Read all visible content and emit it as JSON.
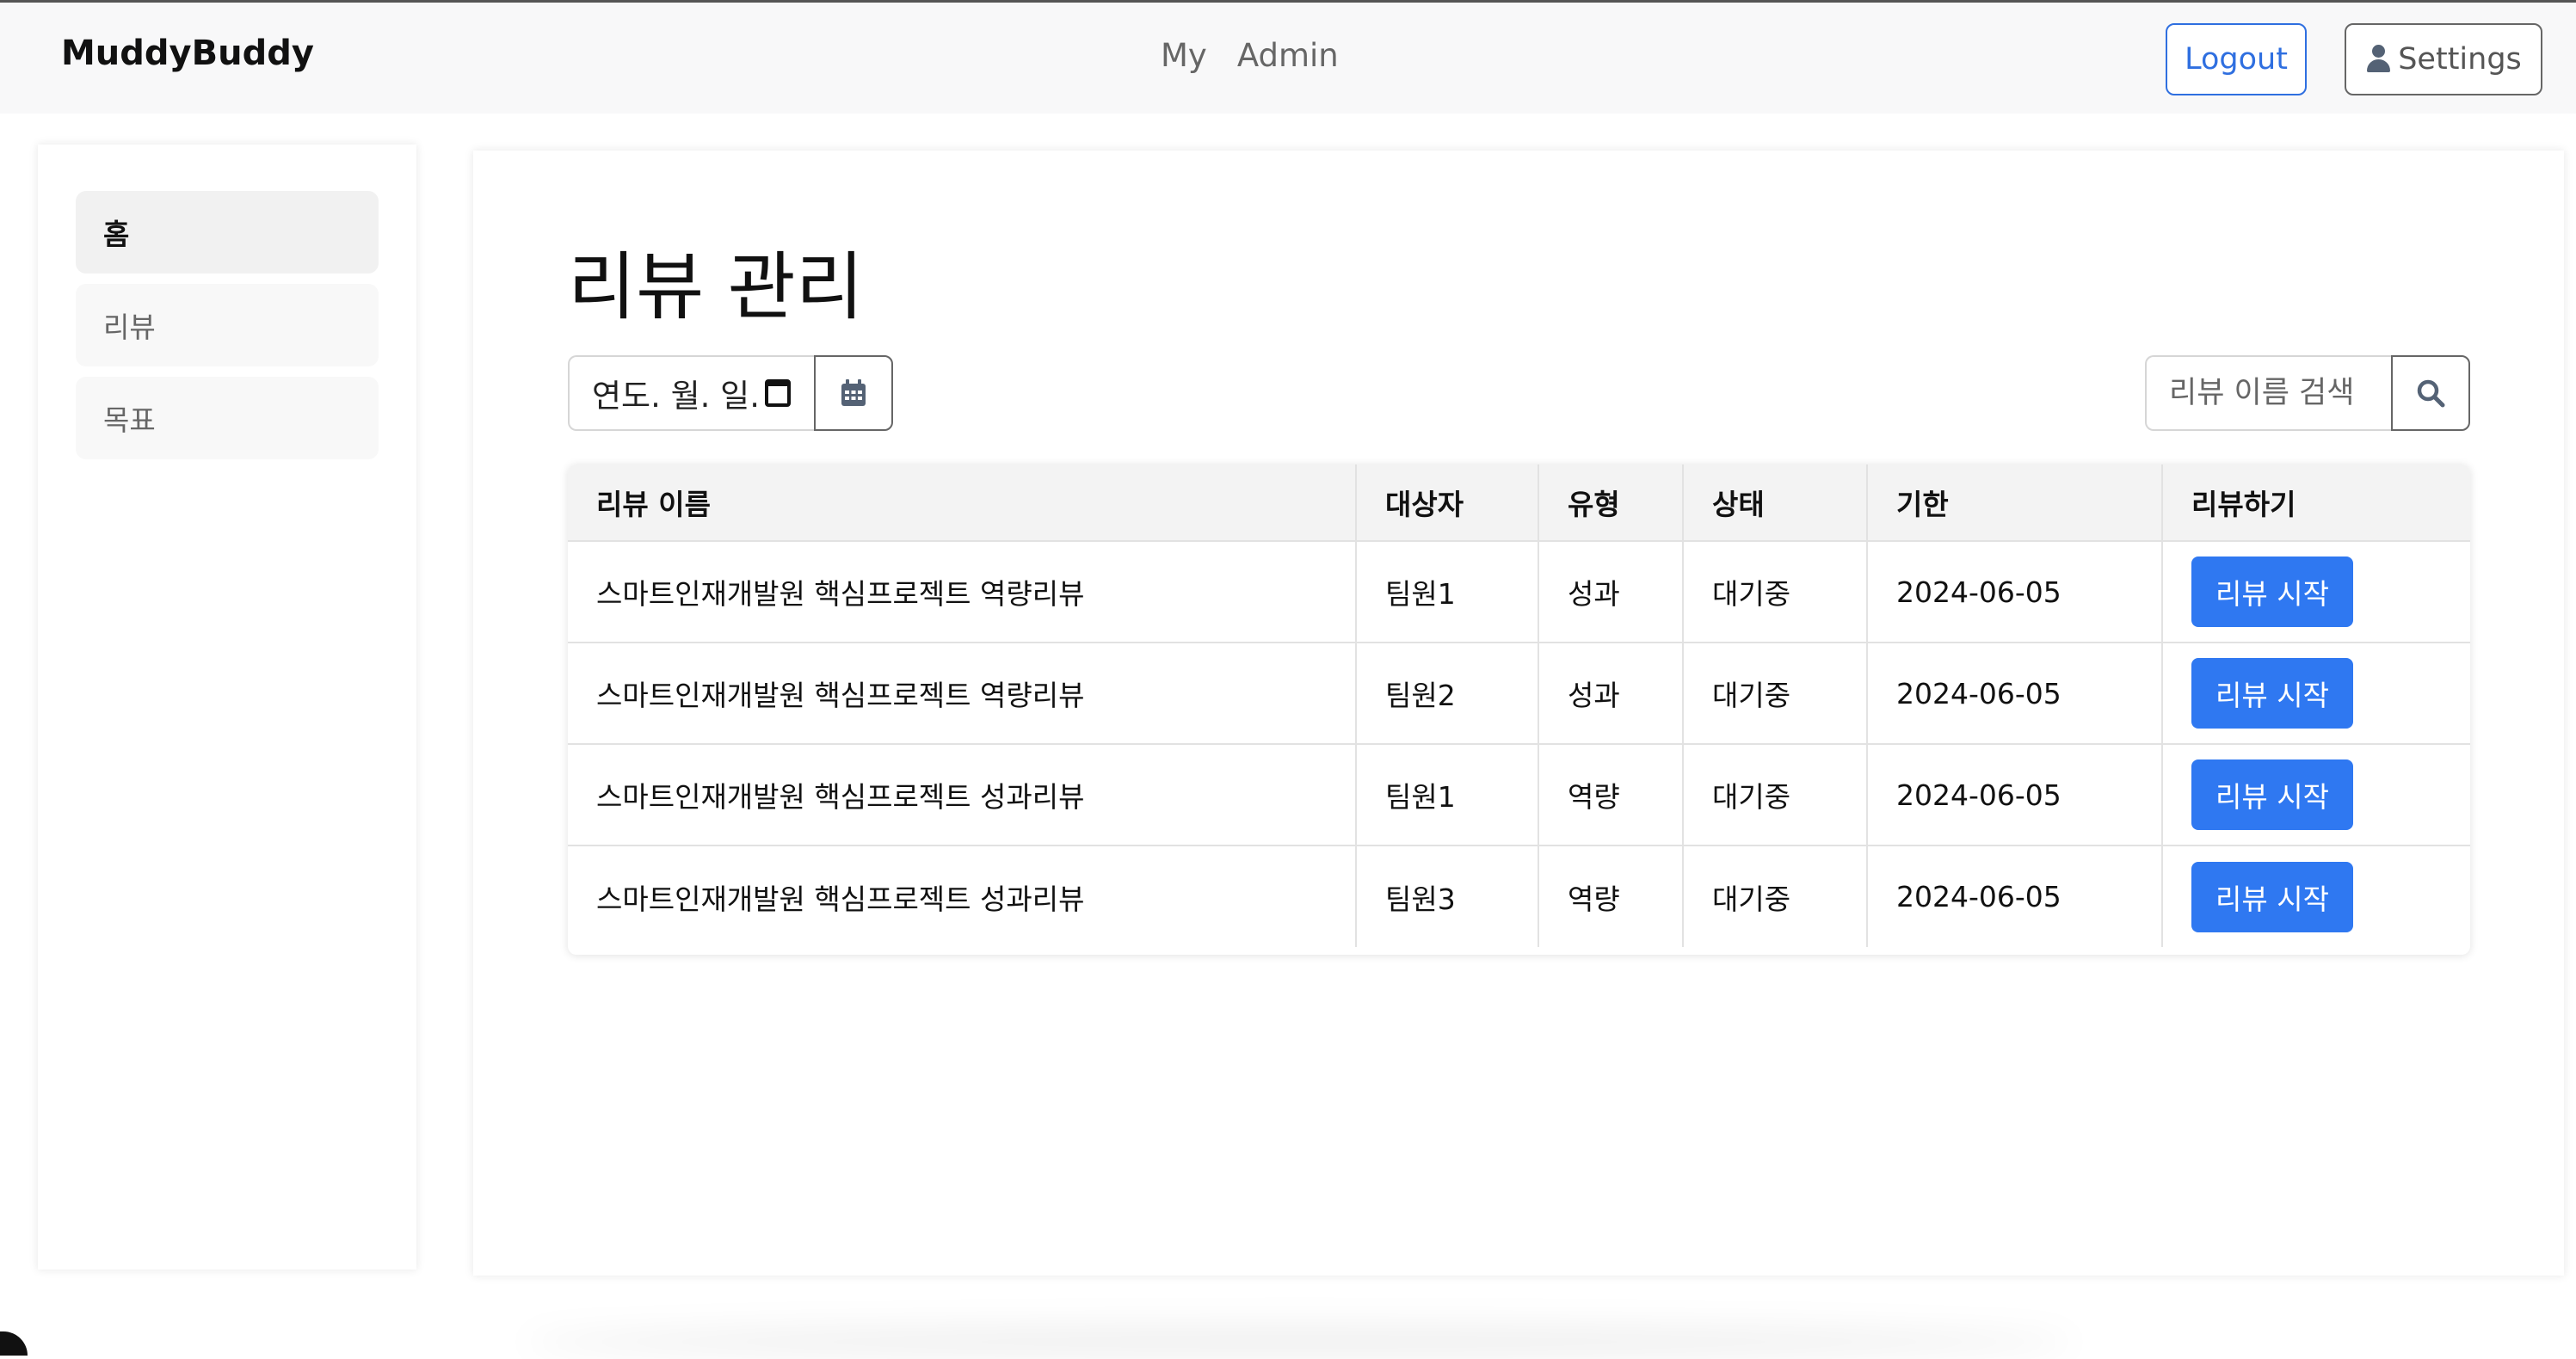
{
  "header": {
    "brand": "MuddyBuddy",
    "nav": [
      "My",
      "Admin"
    ],
    "logout_label": "Logout",
    "settings_label": "Settings",
    "settings_icon": "person-icon"
  },
  "sidebar": {
    "items": [
      {
        "label": "홈",
        "active": true
      },
      {
        "label": "리뷰",
        "active": false
      },
      {
        "label": "목표",
        "active": false
      }
    ]
  },
  "main": {
    "title": "리뷰 관리",
    "date_input": {
      "value": "연도. 월. 일.",
      "icon": "calendar-icon"
    },
    "calendar_button_icon": "calendar-icon",
    "search": {
      "placeholder": "리뷰 이름 검색",
      "icon": "search-icon"
    },
    "table": {
      "columns": [
        "리뷰 이름",
        "대상자",
        "유형",
        "상태",
        "기한",
        "리뷰하기"
      ],
      "rows": [
        {
          "name": "스마트인재개발원 핵심프로젝트 역량리뷰",
          "target": "팀원1",
          "type": "성과",
          "status": "대기중",
          "due": "2024-06-05",
          "action": "리뷰 시작"
        },
        {
          "name": "스마트인재개발원 핵심프로젝트 역량리뷰",
          "target": "팀원2",
          "type": "성과",
          "status": "대기중",
          "due": "2024-06-05",
          "action": "리뷰 시작"
        },
        {
          "name": "스마트인재개발원 핵심프로젝트 성과리뷰",
          "target": "팀원1",
          "type": "역량",
          "status": "대기중",
          "due": "2024-06-05",
          "action": "리뷰 시작"
        },
        {
          "name": "스마트인재개발원 핵심프로젝트 성과리뷰",
          "target": "팀원3",
          "type": "역량",
          "status": "대기중",
          "due": "2024-06-05",
          "action": "리뷰 시작"
        }
      ]
    }
  },
  "colors": {
    "accent": "#2f78f1",
    "logout_border": "#2f6fe0",
    "topbar_bg": "#f8f8f9"
  }
}
